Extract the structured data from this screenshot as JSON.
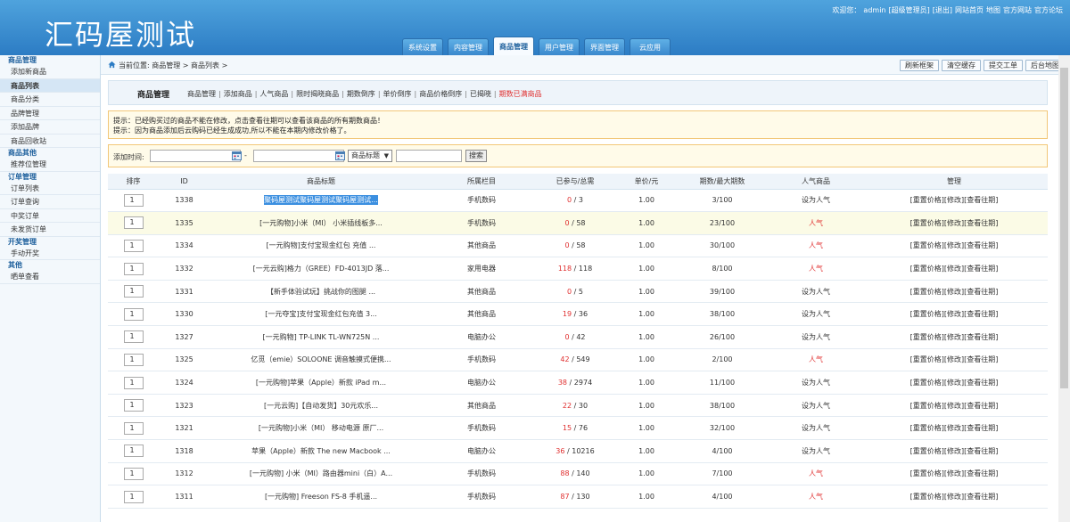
{
  "header": {
    "logo": "汇码屋测试",
    "links": [
      "欢迎您：",
      "admin",
      "[超级管理员]",
      "[退出]",
      "网站首页",
      "地图",
      "官方网站",
      "官方论坛"
    ],
    "tabs": [
      {
        "label": "系统设置",
        "active": false
      },
      {
        "label": "内容管理",
        "active": false
      },
      {
        "label": "商品管理",
        "active": true
      },
      {
        "label": "用户管理",
        "active": false
      },
      {
        "label": "界面管理",
        "active": false
      },
      {
        "label": "云应用",
        "active": false
      }
    ]
  },
  "sidebar": [
    {
      "type": "group",
      "label": "商品管理"
    },
    {
      "type": "item",
      "label": "添加新商品"
    },
    {
      "type": "item",
      "label": "商品列表",
      "active": true
    },
    {
      "type": "item",
      "label": "商品分类"
    },
    {
      "type": "item",
      "label": "品牌管理"
    },
    {
      "type": "item",
      "label": "添加品牌"
    },
    {
      "type": "item",
      "label": "商品回收站"
    },
    {
      "type": "group",
      "label": "商品其他"
    },
    {
      "type": "item",
      "label": "推荐位管理"
    },
    {
      "type": "group",
      "label": "订单管理"
    },
    {
      "type": "item",
      "label": "订单列表"
    },
    {
      "type": "item",
      "label": "订单查询"
    },
    {
      "type": "item",
      "label": "中奖订单"
    },
    {
      "type": "item",
      "label": "未发货订单"
    },
    {
      "type": "group",
      "label": "开奖管理"
    },
    {
      "type": "item",
      "label": "手动开奖"
    },
    {
      "type": "group",
      "label": "其他"
    },
    {
      "type": "item",
      "label": "晒单查看"
    }
  ],
  "breadcrumb": "当前位置: 商品管理 > 商品列表 >",
  "tool_buttons": [
    "刷新框架",
    "清空缓存",
    "提交工单",
    "后台地图"
  ],
  "panel": {
    "title": "商品管理",
    "links": [
      {
        "label": "商品管理",
        "red": false
      },
      {
        "label": "添加商品",
        "red": false
      },
      {
        "label": "人气商品",
        "red": false
      },
      {
        "label": "限时揭晓商品",
        "red": false
      },
      {
        "label": "期数倒序",
        "red": false
      },
      {
        "label": "单价倒序",
        "red": false
      },
      {
        "label": "商品价格倒序",
        "red": false
      },
      {
        "label": "已揭晓",
        "red": false
      },
      {
        "label": "期数已满商品",
        "red": true
      }
    ]
  },
  "tips": [
    "提示：已经购买过的商品不能在修改，点击查看往期可以查看该商品的所有期数商品！",
    "提示：因为商品添加后云购码已经生成成功,所以不能在本期内修改价格了。"
  ],
  "search": {
    "label": "添加时间:",
    "dash": "-",
    "select_value": "商品标题",
    "button": "搜索"
  },
  "table": {
    "headers": [
      "排序",
      "ID",
      "商品标题",
      "所属栏目",
      "已参与/总需",
      "单价/元",
      "期数/最大期数",
      "人气商品",
      "管理"
    ],
    "rows": [
      {
        "sort": "1",
        "id": "1338",
        "title": "聚码屋测试聚码屋测试聚码屋测试...",
        "cat": "手机数码",
        "joined": "0",
        "total": "3",
        "price": "1.00",
        "period": "3/100",
        "hot": "设为人气",
        "hot_red": false,
        "selected": true
      },
      {
        "sort": "1",
        "id": "1335",
        "title": "[一元购物]小米（MI） 小米插线板多...",
        "cat": "手机数码",
        "joined": "0",
        "total": "58",
        "price": "1.00",
        "period": "23/100",
        "hot": "人气",
        "hot_red": true,
        "hl": true
      },
      {
        "sort": "1",
        "id": "1334",
        "title": "[一元购物]支付宝现金红包 充值 ...",
        "cat": "其他商品",
        "joined": "0",
        "total": "58",
        "price": "1.00",
        "period": "30/100",
        "hot": "人气",
        "hot_red": true
      },
      {
        "sort": "1",
        "id": "1332",
        "title": "[一元云购]格力（GREE）FD-4013JD 落...",
        "cat": "家用电器",
        "joined": "118",
        "total": "118",
        "price": "1.00",
        "period": "8/100",
        "hot": "人气",
        "hot_red": true
      },
      {
        "sort": "1",
        "id": "1331",
        "title": "【新手体验试玩】挑战你的图腿 ...",
        "cat": "其他商品",
        "joined": "0",
        "total": "5",
        "price": "1.00",
        "period": "39/100",
        "hot": "设为人气",
        "hot_red": false
      },
      {
        "sort": "1",
        "id": "1330",
        "title": "[一元夺宝]支付宝现金红包充值 3...",
        "cat": "其他商品",
        "joined": "19",
        "total": "36",
        "price": "1.00",
        "period": "38/100",
        "hot": "设为人气",
        "hot_red": false
      },
      {
        "sort": "1",
        "id": "1327",
        "title": "[一元购物] TP-LINK TL-WN725N ...",
        "cat": "电脑办公",
        "joined": "0",
        "total": "42",
        "price": "1.00",
        "period": "26/100",
        "hot": "设为人气",
        "hot_red": false
      },
      {
        "sort": "1",
        "id": "1325",
        "title": "亿觅（emie）SOLOONE 调音触摸式便携...",
        "cat": "手机数码",
        "joined": "42",
        "total": "549",
        "price": "1.00",
        "period": "2/100",
        "hot": "人气",
        "hot_red": true
      },
      {
        "sort": "1",
        "id": "1324",
        "title": "[一元购物]苹果（Apple）新款 iPad m...",
        "cat": "电脑办公",
        "joined": "38",
        "total": "2974",
        "price": "1.00",
        "period": "11/100",
        "hot": "设为人气",
        "hot_red": false
      },
      {
        "sort": "1",
        "id": "1323",
        "title": "[一元云购]【自动发货】30元欢乐...",
        "cat": "其他商品",
        "joined": "22",
        "total": "30",
        "price": "1.00",
        "period": "38/100",
        "hot": "设为人气",
        "hot_red": false
      },
      {
        "sort": "1",
        "id": "1321",
        "title": "[一元购物]小米（MI） 移动电源 原厂...",
        "cat": "手机数码",
        "joined": "15",
        "total": "76",
        "price": "1.00",
        "period": "32/100",
        "hot": "设为人气",
        "hot_red": false
      },
      {
        "sort": "1",
        "id": "1318",
        "title": "苹果（Apple）新款 The new Macbook ...",
        "cat": "电脑办公",
        "joined": "36",
        "total": "10216",
        "price": "1.00",
        "period": "4/100",
        "hot": "设为人气",
        "hot_red": false
      },
      {
        "sort": "1",
        "id": "1312",
        "title": "[一元购物] 小米（MI）路由器mini（白）A...",
        "cat": "手机数码",
        "joined": "88",
        "total": "140",
        "price": "1.00",
        "period": "7/100",
        "hot": "人气",
        "hot_red": true
      },
      {
        "sort": "1",
        "id": "1311",
        "title": "[一元购物] Freeson FS-8 手机遥...",
        "cat": "手机数码",
        "joined": "87",
        "total": "130",
        "price": "1.00",
        "period": "4/100",
        "hot": "人气",
        "hot_red": true
      }
    ],
    "actions": [
      "[重置价格]",
      "[修改]",
      "[查看往期]"
    ]
  },
  "colors": {
    "accent_red": "#e03030",
    "header_blue": "#2c7cc4"
  }
}
